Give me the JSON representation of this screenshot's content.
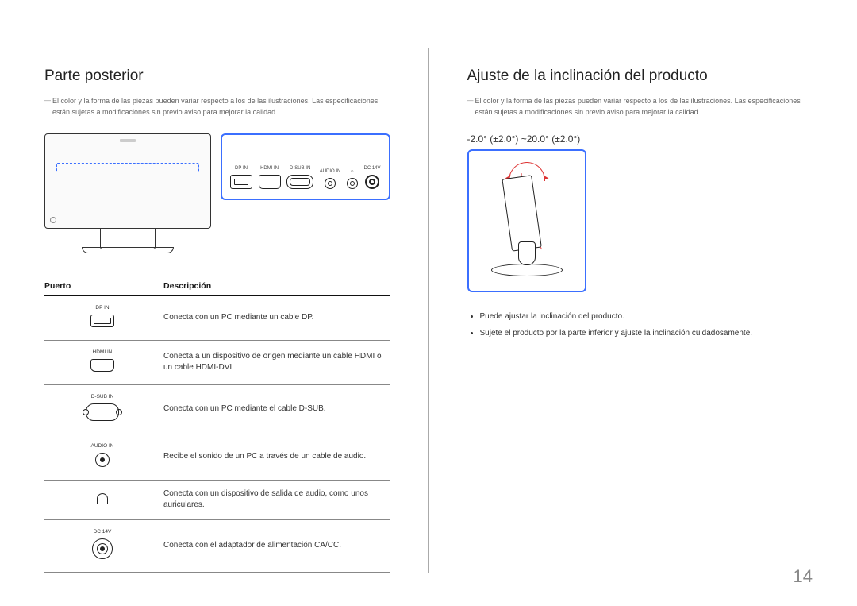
{
  "page_number": "14",
  "left": {
    "heading": "Parte posterior",
    "note": "El color y la forma de las piezas pueden variar respecto a los de las ilustraciones. Las especificaciones están sujetas a modificaciones sin previo aviso para mejorar la calidad.",
    "panel_ports": {
      "dp": "DP IN",
      "hdmi": "HDMI IN",
      "dsub": "D-SUB IN",
      "audio": "AUDIO IN",
      "hp": "",
      "power": "DC 14V"
    },
    "table": {
      "header_port": "Puerto",
      "header_desc": "Descripción",
      "rows": [
        {
          "label": "DP IN",
          "icon": "dp",
          "desc": "Conecta con un PC mediante un cable DP."
        },
        {
          "label": "HDMI IN",
          "icon": "hdmi",
          "desc": "Conecta a un dispositivo de origen mediante un cable HDMI o un cable HDMI-DVI."
        },
        {
          "label": "D-SUB IN",
          "icon": "dsub",
          "desc": "Conecta con un PC mediante el cable D-SUB."
        },
        {
          "label": "AUDIO IN",
          "icon": "jack",
          "desc": "Recibe el sonido de un PC a través de un cable de audio."
        },
        {
          "label": "",
          "icon": "hp",
          "desc": "Conecta con un dispositivo de salida de audio, como unos auriculares."
        },
        {
          "label": "DC 14V",
          "icon": "pwr",
          "desc": "Conecta con el adaptador de alimentación CA/CC."
        }
      ]
    }
  },
  "right": {
    "heading": "Ajuste de la inclinación del producto",
    "note": "El color y la forma de las piezas pueden variar respecto a los de las ilustraciones. Las especificaciones están sujetas a modificaciones sin previo aviso para mejorar la calidad.",
    "tilt_range": "-2.0° (±2.0°) ~20.0° (±2.0°)",
    "bullets": [
      "Puede ajustar la inclinación del producto.",
      "Sujete el producto por la parte inferior y ajuste la inclinación cuidadosamente."
    ]
  }
}
